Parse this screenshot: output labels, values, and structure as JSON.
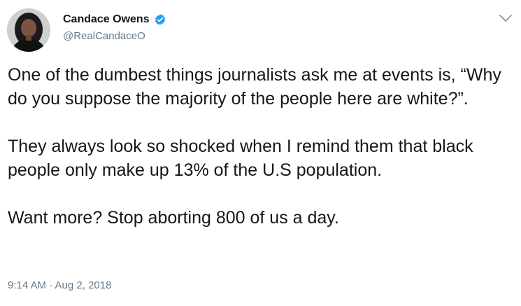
{
  "author": {
    "name": "Candace Owens",
    "handle": "@RealCandaceO",
    "verified": true,
    "verified_color": "#1da1f2"
  },
  "tweet": {
    "paragraphs": [
      "One of the dumbest things journalists ask me at events is, “Why do you suppose the majority of the people here are white?”.",
      "They always look so shocked when I remind them that black people only make up 13% of the U.S population.",
      "Want more? Stop aborting 800 of us a day."
    ],
    "timestamp": "9:14 AM · Aug 2, 2018"
  },
  "icons": {
    "menu": "chevron-down-icon",
    "verified": "verified-badge-icon",
    "avatar": "profile-avatar"
  },
  "colors": {
    "text": "#14171a",
    "secondary_text": "#657786"
  }
}
